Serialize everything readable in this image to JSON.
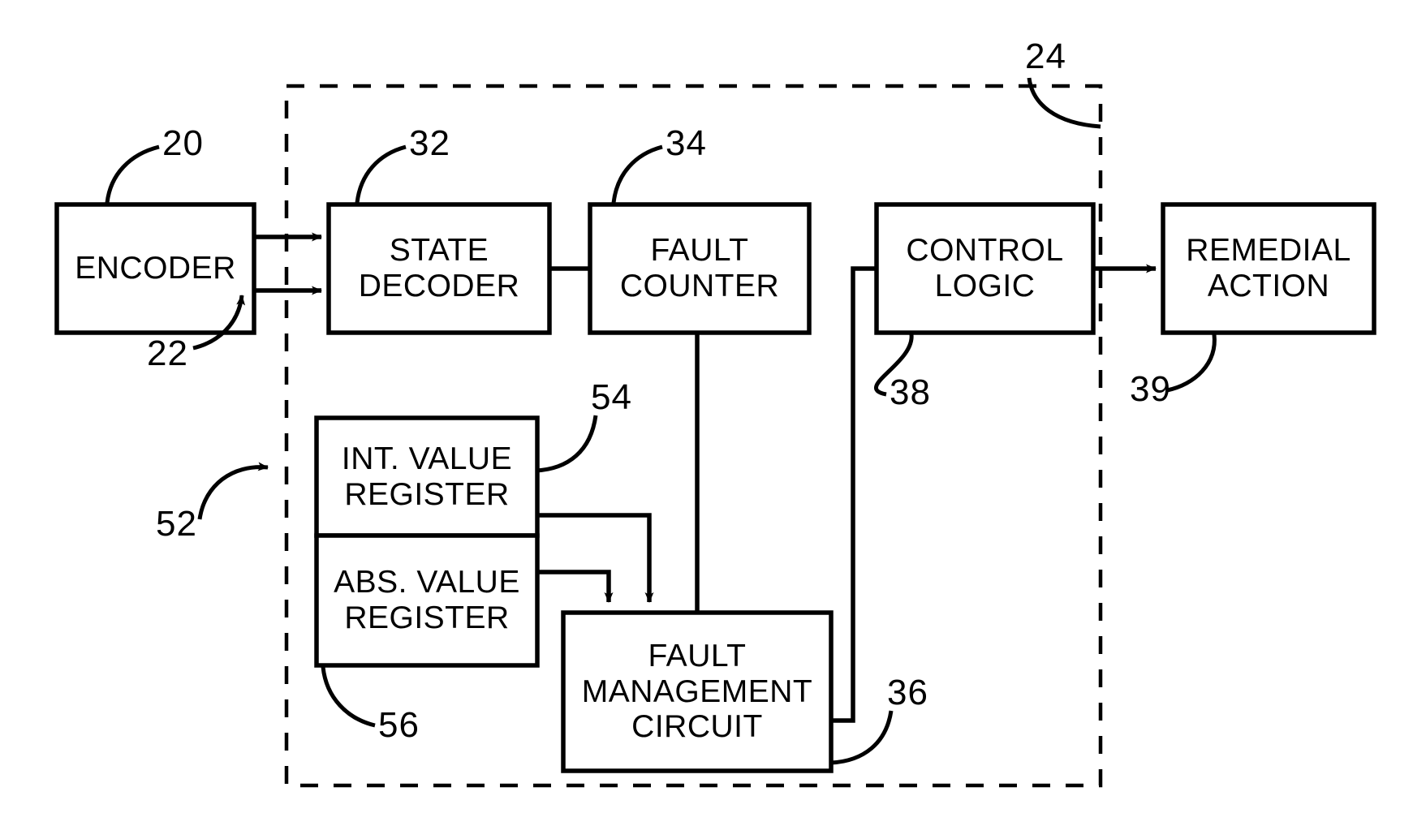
{
  "figure": {
    "type": "patent-block-diagram",
    "stroke_color": "#000000",
    "background_color": "#ffffff",
    "boundary": {
      "name": "system-boundary",
      "style": "dashed",
      "ref": "24"
    }
  },
  "blocks": {
    "encoder": {
      "label_line1": "ENCODER",
      "label_line2": "",
      "ref": "20"
    },
    "state_decoder": {
      "label_line1": "STATE",
      "label_line2": "DECODER",
      "ref": "32"
    },
    "fault_counter": {
      "label_line1": "FAULT",
      "label_line2": "COUNTER",
      "ref": "34"
    },
    "control_logic": {
      "label_line1": "CONTROL",
      "label_line2": "LOGIC",
      "ref": "38"
    },
    "remedial_action": {
      "label_line1": "REMEDIAL",
      "label_line2": "ACTION",
      "ref": "39"
    },
    "int_value_register": {
      "label_line1": "INT. VALUE",
      "label_line2": "REGISTER",
      "ref": "54"
    },
    "abs_value_register": {
      "label_line1": "ABS. VALUE",
      "label_line2": "REGISTER",
      "ref": "56"
    },
    "fault_management_circuit": {
      "label_line1": "FAULT",
      "label_line2": "MANAGEMENT",
      "label_line3": "CIRCUIT",
      "ref": "36"
    }
  },
  "reference_numerals": {
    "encoder": "20",
    "encoder_input_signal": "22",
    "system_boundary": "24",
    "state_decoder": "32",
    "fault_counter": "34",
    "fault_management_circuit": "36",
    "control_logic": "38",
    "remedial_action": "39",
    "register_input_signal": "52",
    "int_value_register": "54",
    "abs_value_register": "56"
  }
}
